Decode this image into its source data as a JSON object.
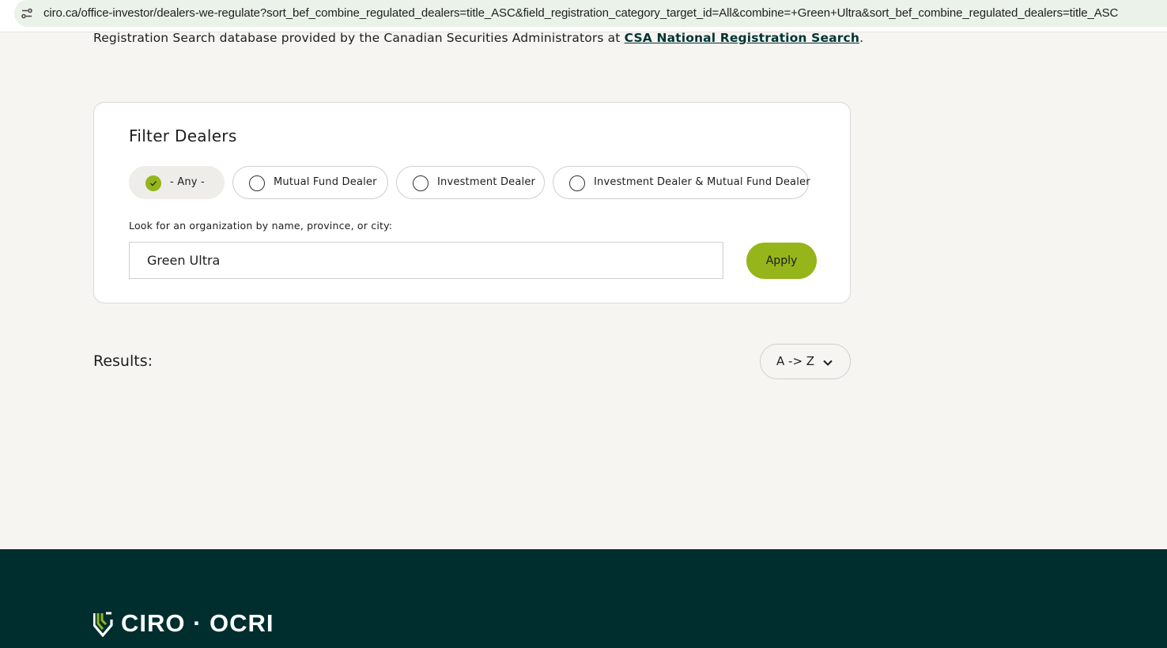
{
  "browser": {
    "url": "ciro.ca/office-investor/dealers-we-regulate?sort_bef_combine_regulated_dealers=title_ASC&field_registration_category_target_id=All&combine=+Green+Ultra&sort_bef_combine_regulated_dealers=title_ASC",
    "site_icon": "site-settings-icon"
  },
  "intro": {
    "text": "Registration Search database provided by the Canadian Securities Administrators at ",
    "link_label": "CSA National Registration Search",
    "trailing": "."
  },
  "filter": {
    "title": "Filter Dealers",
    "options": [
      {
        "label": "- Any -",
        "selected": true
      },
      {
        "label": "Mutual Fund Dealer",
        "selected": false
      },
      {
        "label": "Investment Dealer",
        "selected": false
      },
      {
        "label": "Investment Dealer & Mutual Fund Dealer",
        "selected": false
      }
    ],
    "search_label": "Look for an organization by name, province, or city:",
    "search_value": "Green Ultra",
    "apply_label": "Apply"
  },
  "results": {
    "label": "Results:",
    "sort_value": "A -> Z"
  },
  "footer": {
    "logo_text": "CIRO · OCRI"
  },
  "colors": {
    "accent": "#95b51a",
    "footer_bg": "#002e2f",
    "page_bg": "#f6f5f2",
    "link": "#003432"
  }
}
